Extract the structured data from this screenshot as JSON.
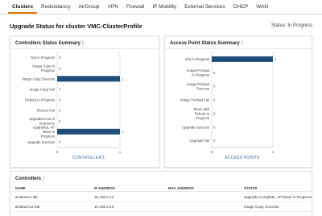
{
  "tabs": [
    "Clusters",
    "Redundancy",
    "AirGroup",
    "VPN",
    "Firewall",
    "IP Mobility",
    "External Services",
    "DHCP",
    "WAN"
  ],
  "active_tab": "Clusters",
  "header": {
    "title": "Upgrade Status for cluster VMC-ClusterProfile",
    "status_label": "Status: In Progress"
  },
  "controllers_panel": {
    "title": "Controllers Status Summary",
    "chevron": "⟩"
  },
  "ap_panel": {
    "title": "Access Point Status Summary",
    "chevron": "⟩"
  },
  "table": {
    "title": "Controllers",
    "chevron": "⟩",
    "columns": [
      "NAME",
      "IP ADDRESS",
      "MAC ADDRESS",
      "STATUS"
    ],
    "rows": [
      {
        "name": "arubavmc-lab",
        "ip": "10.160.0.12",
        "mac": "",
        "status": "Upgrade Complete, AP Move in Progress"
      },
      {
        "name": "arubavmc2-lab",
        "ip": "10.160.0.13",
        "mac": "",
        "status": "Image Copy Success"
      }
    ]
  },
  "chart_data": [
    {
      "type": "bar",
      "orientation": "horizontal",
      "categories": [
        "Not in Progress",
        "Image Copy in Progress",
        "Image Copy Success",
        "Image Copy Fail",
        "Reboot in Progress",
        "Reboot Fail",
        "Upgraded Out of Sequence",
        "Upgraded, AP Move in Progress",
        "Upgrade Success"
      ],
      "values": [
        0,
        0,
        1,
        0,
        0,
        0,
        0,
        1,
        0
      ],
      "xlabel": "CONTROLLERS",
      "xlim": [
        0,
        1
      ],
      "ticks": [
        0,
        1
      ],
      "color": "#1f4e79",
      "grid": true
    },
    {
      "type": "bar",
      "orientation": "horizontal",
      "categories": [
        "Not in Progress",
        "Image Preload in Progress",
        "Image Preload Success",
        "Image Preload Fail",
        "Move with Reboot in Progress",
        "Upgrade Success",
        "Upgrade Fail"
      ],
      "values": [
        1,
        0,
        0,
        0,
        0,
        0,
        0
      ],
      "xlabel": "ACCESS POINTS",
      "xlim": [
        0,
        1
      ],
      "ticks": [
        0,
        1
      ],
      "color": "#1f4e79",
      "grid": true
    }
  ]
}
